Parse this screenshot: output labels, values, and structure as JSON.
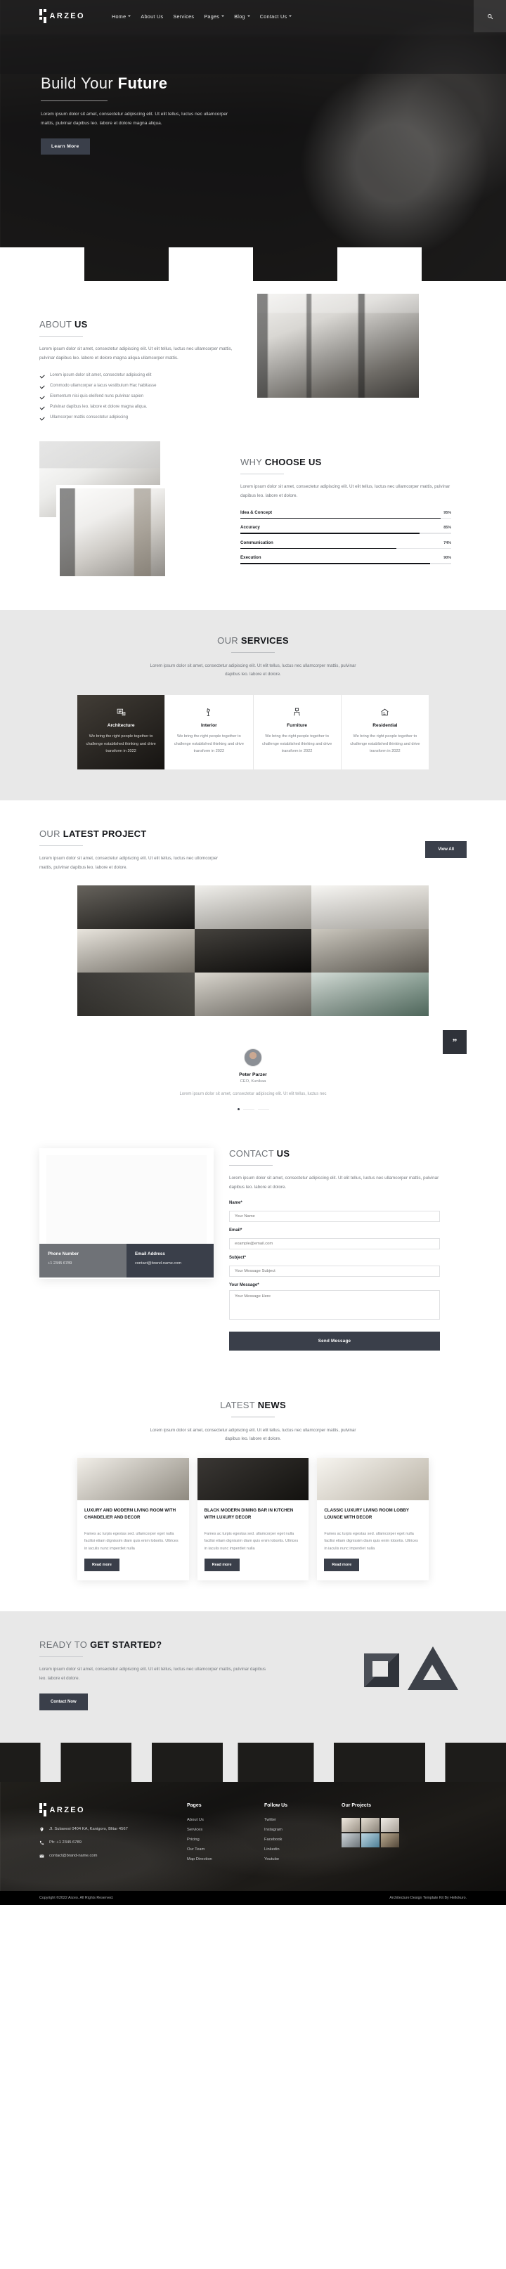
{
  "brand": {
    "name": "ARZEO"
  },
  "nav": {
    "items": [
      {
        "label": "Home",
        "caret": true
      },
      {
        "label": "About Us",
        "caret": false
      },
      {
        "label": "Services",
        "caret": false
      },
      {
        "label": "Pages",
        "caret": true
      },
      {
        "label": "Blog",
        "caret": true
      },
      {
        "label": "Contact Us",
        "caret": true
      }
    ],
    "search_icon": "search-icon"
  },
  "hero": {
    "title_light": "Build Your",
    "title_bold": "Future",
    "paragraph": "Lorem ipsum dolor sit amet, consectetur adipiscing elit. Ut elit tellus, luctus nec ullamcorper mattis, pulvinar dapibus leo. labore et dolore magna aliqua.",
    "button": "Learn More"
  },
  "about": {
    "title_light": "ABOUT",
    "title_bold": "US",
    "paragraph": "Lorem ipsum dolor sit amet, consectetur adipiscing elit. Ut elit tellus, luctus nec ullamcorper mattis, pulvinar dapibus leo. labore et dolore magna aliqua ullamcorper mattis.",
    "checks": [
      "Lorem ipsum dolor sit amet, consectetur adipiscing elit",
      "Commodo ullamcorper a lacus vestibulum Hac habitasse",
      "Elementum nisi quis eleifend nunc pulvinar sapien",
      "Pulvinar dapibus leo. labore et dolore magna aliqua.",
      "Ullamcorper mattis consectetur adipiscing"
    ]
  },
  "why": {
    "title_light": "WHY",
    "title_bold": "CHOOSE US",
    "paragraph": "Lorem ipsum dolor sit amet, consectetur adipiscing elit. Ut elit tellus, luctus nec ullamcorper mattis, pulvinar dapibus leo. labore et dolore.",
    "bars": [
      {
        "label": "Idea & Concept",
        "value": "95%",
        "pct": 95
      },
      {
        "label": "Accuracy",
        "value": "85%",
        "pct": 85
      },
      {
        "label": "Communication",
        "value": "74%",
        "pct": 74
      },
      {
        "label": "Execution",
        "value": "90%",
        "pct": 90
      }
    ]
  },
  "services": {
    "title_light": "OUR",
    "title_bold": "SERVICES",
    "paragraph": "Lorem ipsum dolor sit amet, consectetur adipiscing elit. Ut elit tellus, luctus nec ullamcorper mattis, pulvinar dapibus leo. labore et dolore.",
    "cards": [
      {
        "title": "Architecture",
        "icon": "blueprint-icon",
        "text": "We bring the right people together to challenge established thinking and drive transform in 2022"
      },
      {
        "title": "Interior",
        "icon": "lamp-icon",
        "text": "We bring the right people together to challenge established thinking and drive transform in 2022"
      },
      {
        "title": "Furniture",
        "icon": "chair-icon",
        "text": "We bring the right people together to challenge established thinking and drive transform in 2022"
      },
      {
        "title": "Residential",
        "icon": "house-icon",
        "text": "We bring the right people together to challenge established thinking and drive transform in 2022"
      }
    ]
  },
  "projects": {
    "title_light": "OUR",
    "title_bold": "LATEST PROJECT",
    "paragraph": "Lorem ipsum dolor sit amet, consectetur adipiscing elit. Ut elit tellus, luctus nec ullomcorper mattis, pulvinar dapibus leo. labore et dolore.",
    "view_all": "View All"
  },
  "testimonial": {
    "quote_mark": "”",
    "name": "Peter Parzer",
    "role": "CEO, Kunikaa",
    "text": "Lorem ipsum dolor sit amet, consectetur adipiscing elit. Ut elit tellus, luctus nec"
  },
  "contact": {
    "title_light": "CONTACT",
    "title_bold": "US",
    "paragraph": "Lorem ipsum dolor sit amet, consectetur adipiscing elit. Ut elit tellus, luctus nec ullamcorper mattis, pulvinar dapibus leo. labore et dolore.",
    "phone_title": "Phone Number",
    "phone_value": "+1 2345 6789",
    "email_title": "Email Address",
    "email_value": "contact@brand-name.com",
    "fields": {
      "name_label": "Name*",
      "name_placeholder": "Your Name",
      "email_label": "Email*",
      "email_placeholder": "example@email.com",
      "subject_label": "Subject*",
      "subject_placeholder": "Your Message Subject",
      "message_label": "Your Message*",
      "message_placeholder": "Your Message Here"
    },
    "submit": "Send Message"
  },
  "news": {
    "title_light": "LATEST",
    "title_bold": "NEWS",
    "paragraph": "Lorem ipsum dolor sit amet, consectetur adipiscing elit. Ut elit tellus, luctus nec ullamcorper mattis, pulvinar dapibus leo. labore et dolore.",
    "read_more": "Read more",
    "cards": [
      {
        "title": "LUXURY AND MODERN LIVING ROOM WITH CHANDELIER AND DECOR",
        "text": "Fames ac turpis egestas sed. ullamcorper eget nulla facilisi etiam dignissim diam quis enim lobortis. Ultrices in iaculis nunc imperdiet nulla"
      },
      {
        "title": "BLACK MODERN DINING BAR IN KITCHEN WITH LUXURY DECOR",
        "text": "Fames ac turpis egestas sed. ullamcorper eget nulla facilisi etiam dignissim diam quis enim lobortis. Ultrices in iaculis nunc imperdiet nulla"
      },
      {
        "title": "CLASSIC LUXURY LIVING ROOM LOBBY LOUNGE WITH DECOR",
        "text": "Fames ac turpis egestas sed. ullamcorper eget nulla facilisi etiam dignissim diam quis enim lobortis. Ultrices in iaculis nunc imperdiet nulla"
      }
    ]
  },
  "cta": {
    "title_light": "READY TO",
    "title_bold": "GET STARTED?",
    "paragraph": "Lorem ipsum dolor sit amet, consectetur adipiscing elit. Ut elit tellus, luctus nec ullamcorper mattis, pulvinar dapibus leo. labore et dolore.",
    "button": "Contact Now"
  },
  "footer": {
    "address": "Jl. Sulawesi 0404 KA, Kanigoro, Blitar 4567",
    "phone": "Ph: +1 2345 6789",
    "email": "contact@brand-name.com",
    "pages_heading": "Pages",
    "pages": [
      "About Us",
      "Services",
      "Pricing",
      "Our Team",
      "Map Direction"
    ],
    "follow_heading": "Follow Us",
    "follow": [
      "Twitter",
      "Instagram",
      "Facebook",
      "Linkedin",
      "Youtube"
    ],
    "projects_heading": "Our Projects",
    "copyright": "Copyright ©2022 Arzeo. All Rights Reserved.",
    "credit": "Architecture Design Template Kit By Hellokuro."
  },
  "colors": {
    "accent": "#3a3f4a",
    "dark": "#14161a",
    "muted": "#e8e8e8"
  }
}
